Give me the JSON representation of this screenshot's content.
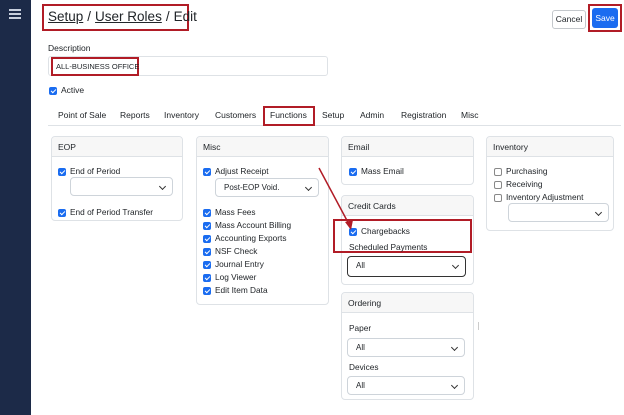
{
  "breadcrumb": {
    "setup": "Setup",
    "user_roles": "User Roles",
    "edit": "Edit",
    "separator": "/"
  },
  "toolbar": {
    "cancel_label": "Cancel",
    "save_label": "Save"
  },
  "description": {
    "label": "Description",
    "value": "ALL-BUSINESS OFFICE"
  },
  "active": {
    "label": "Active",
    "checked": true
  },
  "tabs": [
    "Point of Sale",
    "Reports",
    "Inventory",
    "Customers",
    "Functions",
    "Setup",
    "Admin",
    "Registration",
    "Misc"
  ],
  "active_tab": "Functions",
  "eop": {
    "title": "EOP",
    "end_of_period": "End of Period",
    "end_of_period_select": "",
    "end_of_period_transfer": "End of Period Transfer"
  },
  "misc": {
    "title": "Misc",
    "adjust_receipt": "Adjust Receipt",
    "adjust_receipt_select": "Post-EOP Void.",
    "items": [
      "Mass Fees",
      "Mass Account Billing",
      "Accounting Exports",
      "NSF Check",
      "Journal Entry",
      "Log Viewer",
      "Edit Item Data"
    ]
  },
  "email": {
    "title": "Email",
    "mass_email": "Mass Email"
  },
  "credit_cards": {
    "title": "Credit Cards",
    "chargebacks": "Chargebacks",
    "scheduled_payments": "Scheduled Payments",
    "scheduled_select": "All"
  },
  "ordering": {
    "title": "Ordering",
    "paper_label": "Paper",
    "paper_select": "All",
    "devices_label": "Devices",
    "devices_select": "All"
  },
  "inventory": {
    "title": "Inventory",
    "purchasing": "Purchasing",
    "receiving": "Receiving",
    "inventory_adjustment": "Inventory Adjustment",
    "adjustment_select": ""
  },
  "colors": {
    "sidebar": "#1c2a48",
    "accent": "#1a6cf0",
    "highlight": "#b11c26"
  }
}
